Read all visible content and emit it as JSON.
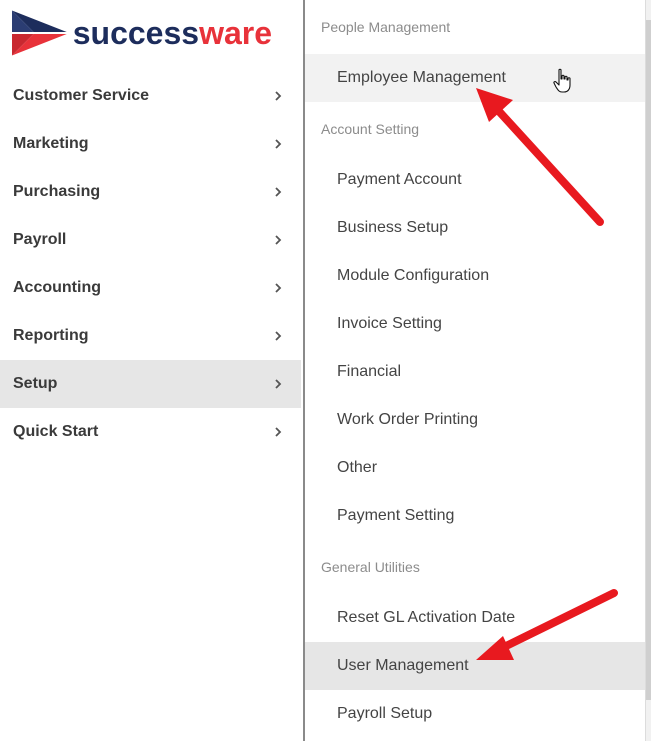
{
  "brand": {
    "name_part1": "success",
    "name_part2": "ware",
    "colors": {
      "navy": "#1d2d5c",
      "red": "#e8323a"
    }
  },
  "sidebar": {
    "items": [
      {
        "label": "Customer Service",
        "active": false
      },
      {
        "label": "Marketing",
        "active": false
      },
      {
        "label": "Purchasing",
        "active": false
      },
      {
        "label": "Payroll",
        "active": false
      },
      {
        "label": "Accounting",
        "active": false
      },
      {
        "label": "Reporting",
        "active": false
      },
      {
        "label": "Setup",
        "active": true
      },
      {
        "label": "Quick Start",
        "active": false
      }
    ]
  },
  "submenu": {
    "groups": [
      {
        "title": "People Management",
        "items": [
          "Employee Management"
        ]
      },
      {
        "title": "Account Setting",
        "items": [
          "Payment Account",
          "Business Setup",
          "Module Configuration",
          "Invoice Setting",
          "Financial",
          "Work Order Printing",
          "Other",
          "Payment Setting"
        ]
      },
      {
        "title": "General Utilities",
        "items": [
          "Reset GL Activation Date",
          "User Management",
          "Payroll Setup"
        ]
      }
    ],
    "hovered_item": "Employee Management",
    "selected_item": "User Management"
  },
  "annotations": {
    "arrow_color": "#e8191f"
  },
  "icons": [
    "successware-logo-icon",
    "chevron-right-icon",
    "hand-cursor-icon",
    "red-arrow-icon"
  ]
}
